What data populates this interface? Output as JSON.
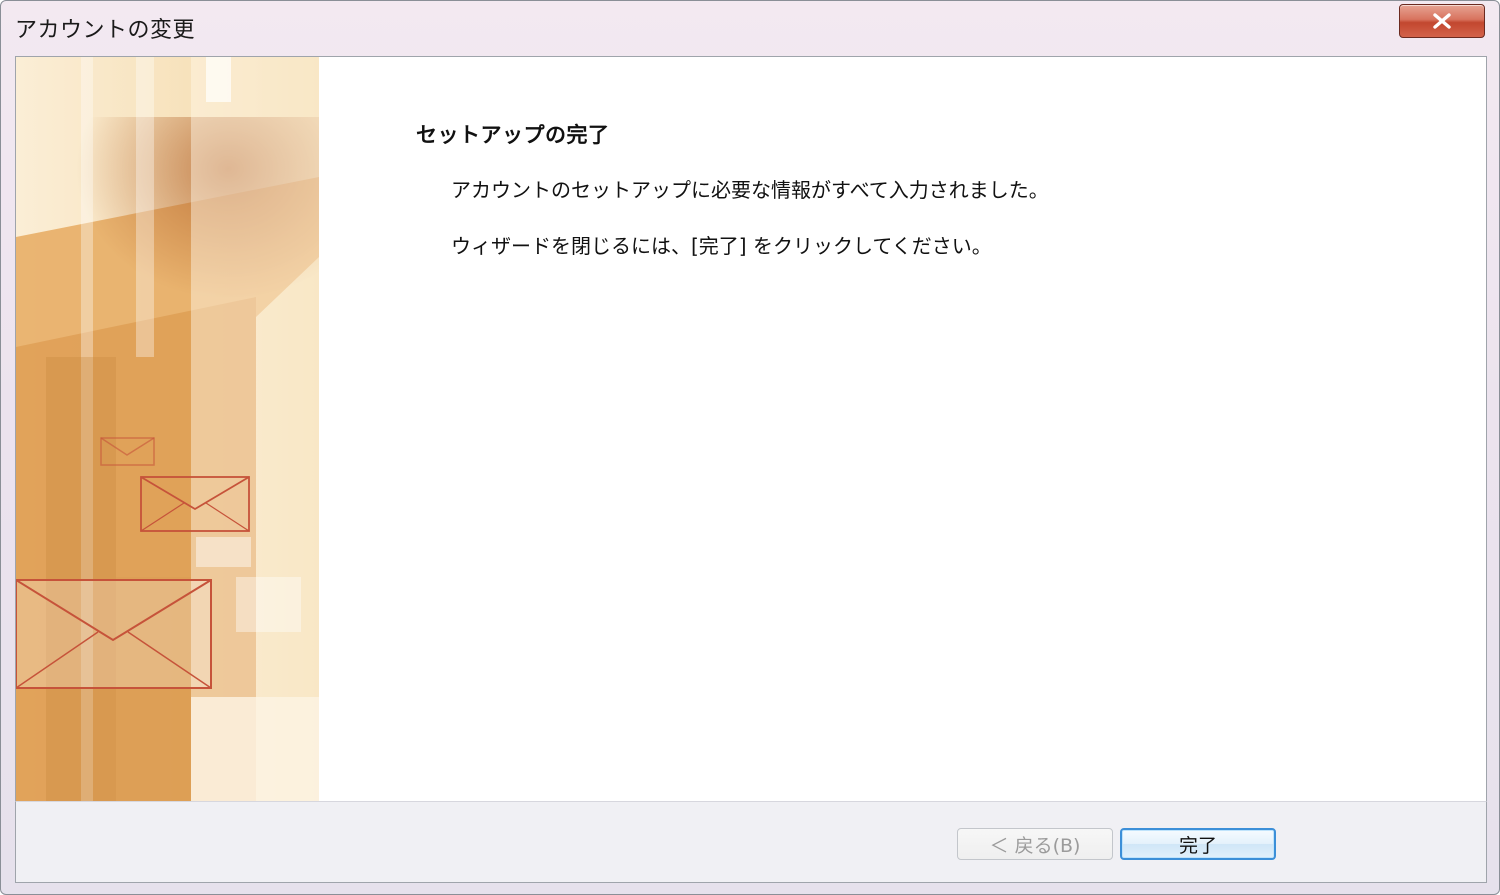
{
  "window": {
    "title": "アカウントの変更",
    "close_icon": "close-x-icon"
  },
  "main": {
    "heading": "セットアップの完了",
    "line1": "アカウントのセットアップに必要な情報がすべて入力されました。",
    "line2": "ウィザードを閉じるには、[完了] をクリックしてください。"
  },
  "banner": {
    "decoration": "mail-envelopes-banner"
  },
  "footer": {
    "back_label": "＜ 戻る(B)",
    "back_enabled": false,
    "finish_label": "完了"
  },
  "colors": {
    "banner_accent": "#e4ab62",
    "envelope_line": "#c6533a",
    "finish_border": "#3c8fd8"
  }
}
